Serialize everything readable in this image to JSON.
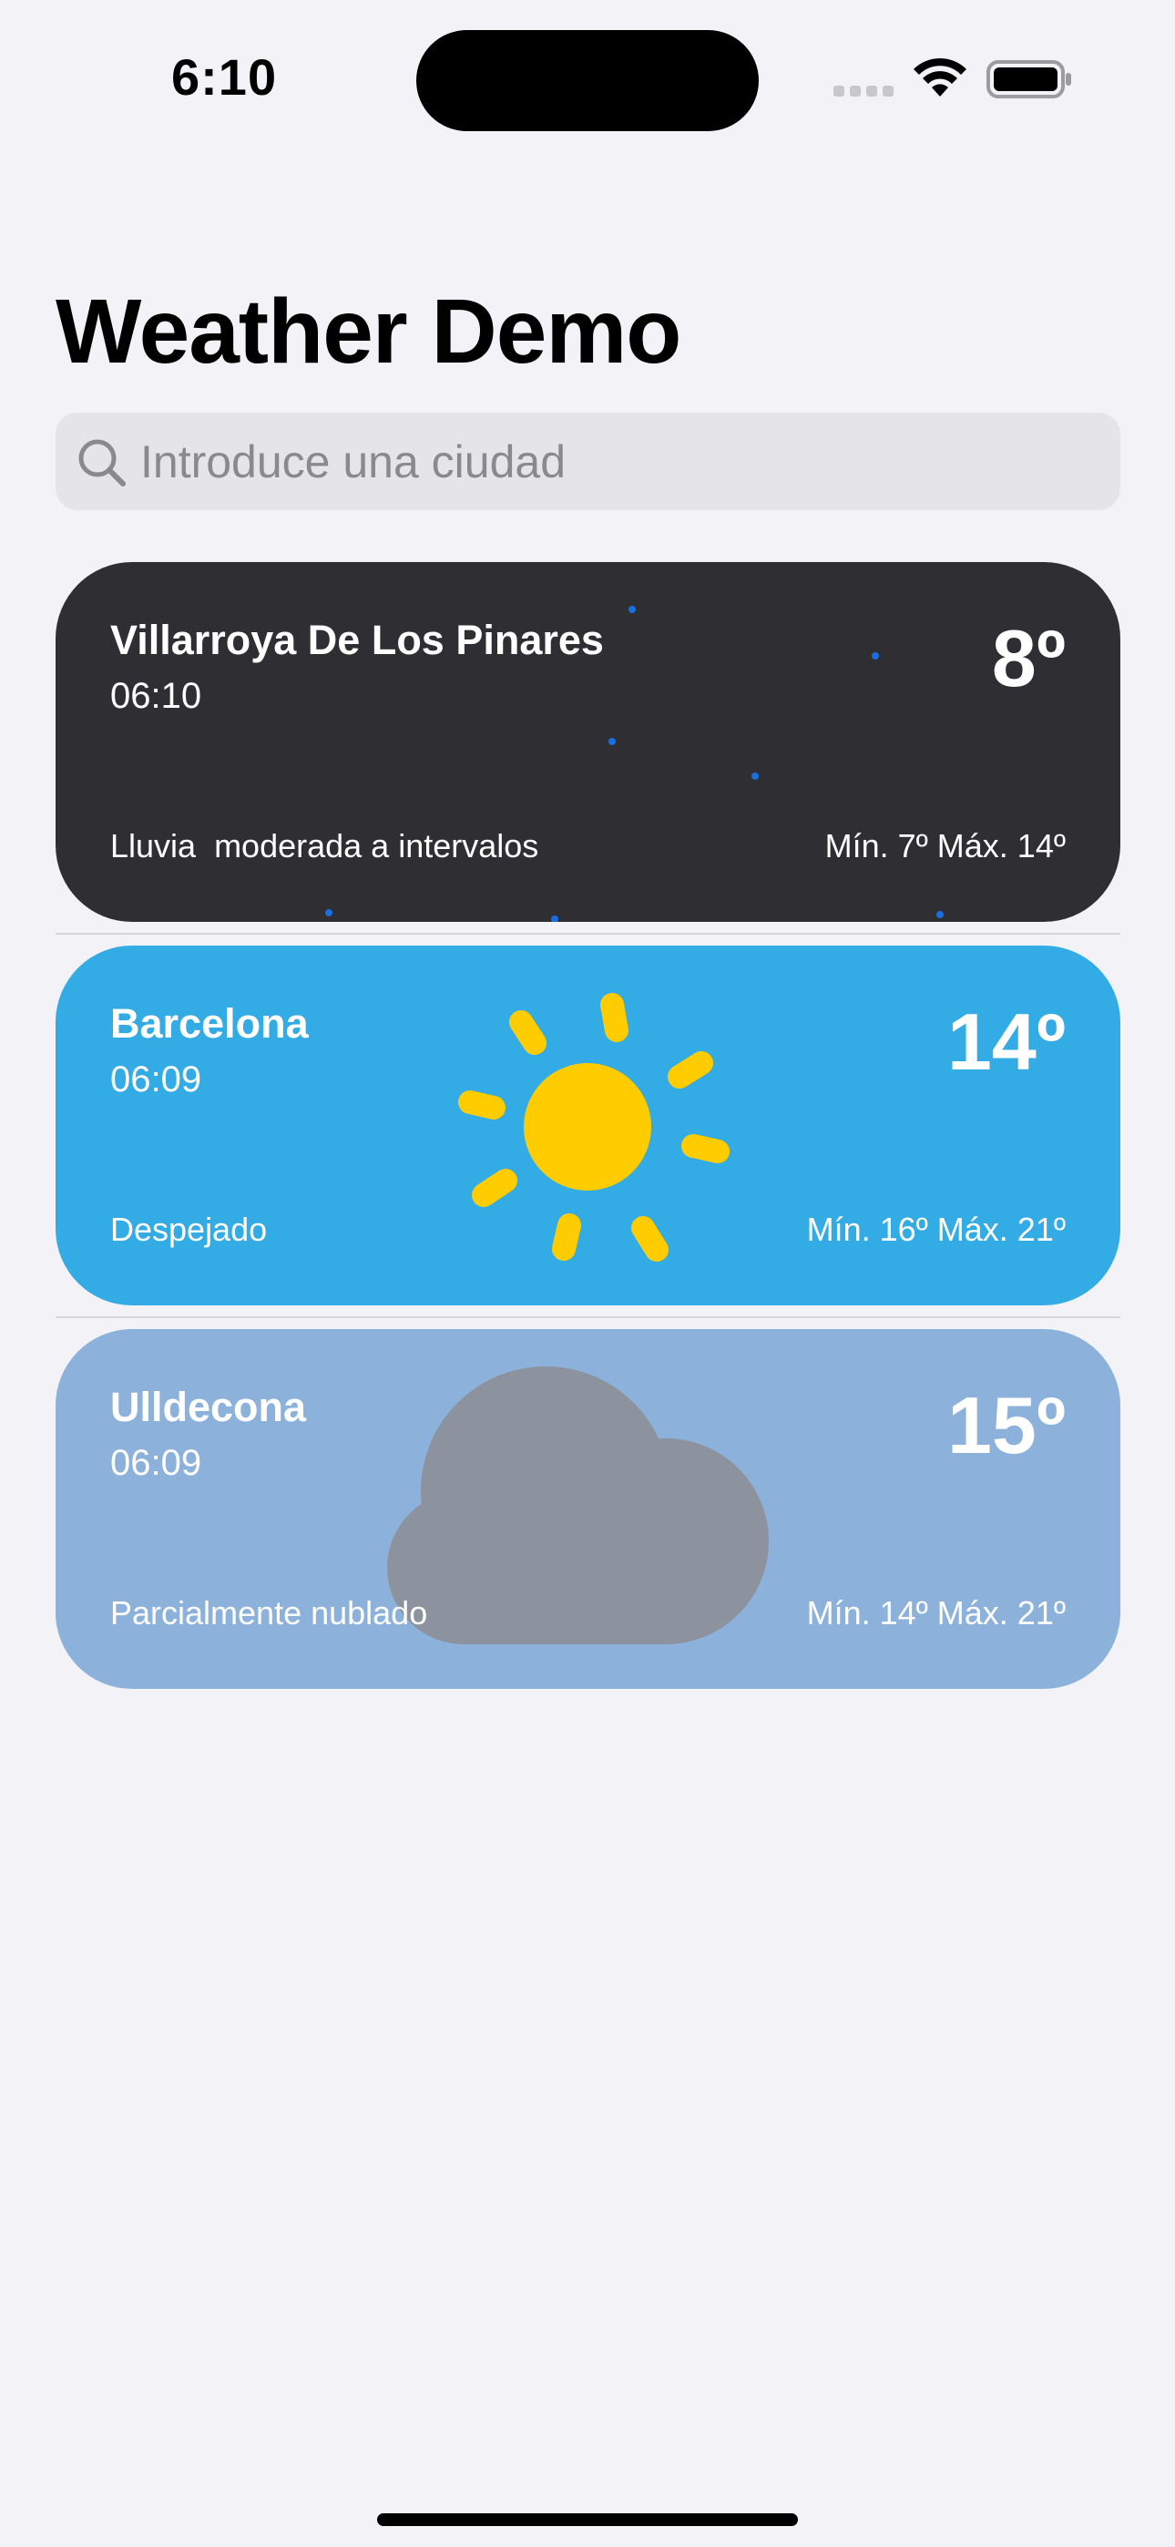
{
  "status_bar": {
    "time": "6:10"
  },
  "header": {
    "title": "Weather Demo"
  },
  "search": {
    "placeholder": "Introduce una ciudad",
    "value": ""
  },
  "colors": {
    "rain_card_bg": "#2f2e33",
    "sunny_card_bg": "#33abe4",
    "cloudy_card_bg": "#8cb1da",
    "sun": "#ffcc00",
    "cloud": "#8c939f",
    "rain_drops": "#1a6fe0"
  },
  "cards": [
    {
      "city": "Villarroya De Los Pinares",
      "time": "06:10",
      "temp": "8º",
      "condition": "Lluvia  moderada a intervalos",
      "min_max": "Mín. 7º Máx. 14º",
      "icon": "rain-icon"
    },
    {
      "city": "Barcelona",
      "time": "06:09",
      "temp": "14º",
      "condition": "Despejado",
      "min_max": "Mín. 16º Máx. 21º",
      "icon": "sun-icon"
    },
    {
      "city": "Ulldecona",
      "time": "06:09",
      "temp": "15º",
      "condition": "Parcialmente nublado",
      "min_max": "Mín. 14º Máx. 21º",
      "icon": "cloud-icon"
    }
  ]
}
